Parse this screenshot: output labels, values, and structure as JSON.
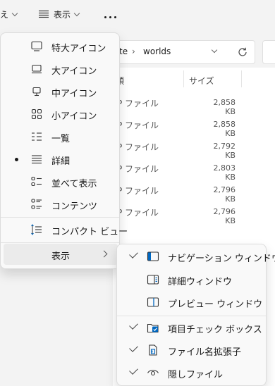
{
  "toolbar": {
    "sort_label": "え",
    "view_label": "表示",
    "more_icon": "more-horizontal-icon"
  },
  "address": {
    "fragment": "te",
    "separator": "›",
    "current": "worlds"
  },
  "list": {
    "col_type": "類",
    "col_size": "サイズ",
    "rows": [
      {
        "type": "P ファイル",
        "size": "2,858 KB"
      },
      {
        "type": "P ファイル",
        "size": "2,858 KB"
      },
      {
        "type": "P ファイル",
        "size": "2,792 KB"
      },
      {
        "type": "P ファイル",
        "size": "2,803 KB"
      },
      {
        "type": "P ファイル",
        "size": "2,796 KB"
      },
      {
        "type": "P ファイル",
        "size": "2,796 KB"
      }
    ]
  },
  "view_menu": {
    "items": [
      {
        "label": "特大アイコン",
        "icon": "monitor-icon",
        "selected": false
      },
      {
        "label": "大アイコン",
        "icon": "laptop-icon",
        "selected": false
      },
      {
        "label": "中アイコン",
        "icon": "desktop-icon",
        "selected": false
      },
      {
        "label": "小アイコン",
        "icon": "grid-icon",
        "selected": false
      },
      {
        "label": "一覧",
        "icon": "list-icon",
        "selected": false
      },
      {
        "label": "詳細",
        "icon": "details-icon",
        "selected": true
      },
      {
        "label": "並べて表示",
        "icon": "tiles-icon",
        "selected": false
      },
      {
        "label": "コンテンツ",
        "icon": "content-icon",
        "selected": false
      },
      {
        "label": "コンパクト ビュー",
        "icon": "compact-view-icon",
        "selected": false
      },
      {
        "label": "表示",
        "icon": "",
        "submenu": true
      }
    ]
  },
  "show_submenu": {
    "items": [
      {
        "label": "ナビゲーション ウィンドウ",
        "icon": "navigation-pane-icon",
        "checked": true
      },
      {
        "label": "詳細ウィンドウ",
        "icon": "details-pane-icon",
        "checked": false
      },
      {
        "label": "プレビュー ウィンドウ",
        "icon": "preview-pane-icon",
        "checked": false
      },
      {
        "label": "項目チェック ボックス",
        "icon": "item-checkbox-icon",
        "checked": true
      },
      {
        "label": "ファイル名拡張子",
        "icon": "file-extension-icon",
        "checked": true
      },
      {
        "label": "隠しファイル",
        "icon": "hidden-eye-icon",
        "checked": true
      }
    ]
  }
}
